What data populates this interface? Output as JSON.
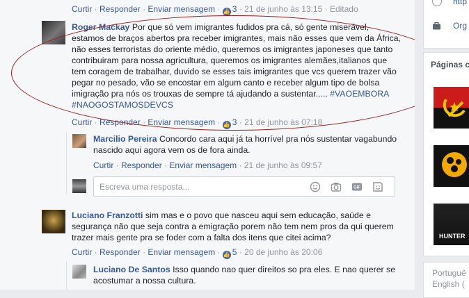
{
  "top_actions": {
    "curtir": "Curtir",
    "responder": "Responder",
    "enviar": "Enviar mensagem",
    "likes": "3",
    "date": "21 de junho às 13:15",
    "editado": "Editado"
  },
  "comments": [
    {
      "author": "Roger Mackay",
      "text": "Por que só vem imigrantes fudidos pra cá, só gente miserável, estamos de braços abertos pra receber imigrantes, mais não esses que vem da África, não esses terroristas do oriente médio, queremos os imigrantes japoneses que tanto contribuiram para nossa agricultura, queremos os imigrantes alemães,italianos que tem coragem de trabalhar, duvido se esses tais imigrantes que vcs querem trazer vão pegar no pesado, vão se encostar em algum canto e receber algum tipo de bolsa imigração pra nós os trouxas de sempre tá ajudando a sustentar.....",
      "hashtags": "#VAOEMBORA #NAOGOSTAMOSDEVCS",
      "actions": {
        "curtir": "Curtir",
        "responder": "Responder",
        "enviar": "Enviar mensagem",
        "likes": "3",
        "date": "21 de junho às 07:18"
      }
    },
    {
      "author": "Marcilio Pereira",
      "text": "Concordo cara aqui já ta horrível pra nós sustentar vagabundo nascido aqui agora vem os de fora ainda.",
      "actions": {
        "curtir": "Curtir",
        "responder": "Responder",
        "enviar": "Enviar mensagem",
        "date": "21 de junho às 09:57"
      }
    },
    {
      "author": "Luciano Franzotti",
      "text": "sim mas e o povo que nasceu aqui sem educação, saúde e segurança não que seja contra a emigração porem não tem nem pros da qui querem trazer mais gente pra se foder com a falta dos itens que citei acima?",
      "actions": {
        "curtir": "Curtir",
        "responder": "Responder",
        "enviar": "Enviar mensagem",
        "likes": "5",
        "date": "20 de junho às 20:06"
      }
    },
    {
      "author": "Luciano De Santos",
      "text": "Isso quando nao quer direitos so pra eles. E nao querer se acostumar a nossa cultura."
    }
  ],
  "reply_input": {
    "placeholder": "Escreva uma resposta..."
  },
  "sidebar": {
    "link_top": "http",
    "org": "Org",
    "pages_heading": "Páginas c",
    "language": "Portuguê",
    "language_2": "English (",
    "ad_text": "HUNTER"
  },
  "colors": {
    "link": "#365899",
    "like": "#4267b2",
    "annotation": "#9b1c1c"
  }
}
